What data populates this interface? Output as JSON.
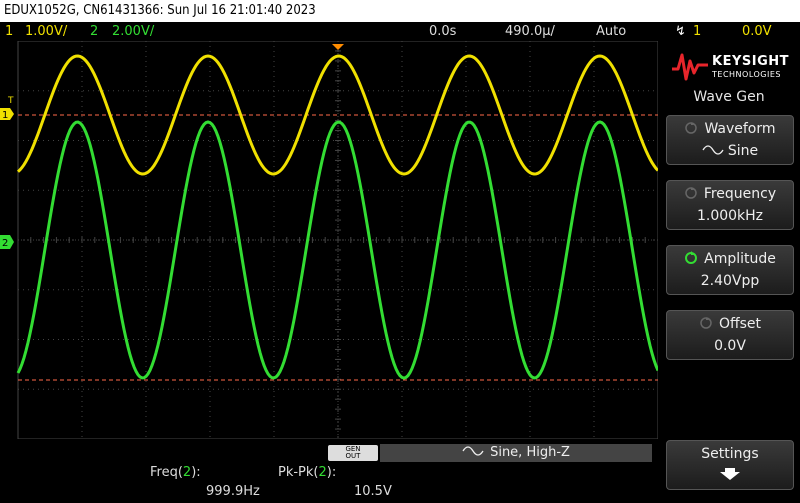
{
  "topbar": {
    "text": "EDUX1052G, CN61431366: Sun Jul 16 21:01:40 2023"
  },
  "status": {
    "ch1_num": "1",
    "ch1_scale": "1.00V/",
    "ch2_num": "2",
    "ch2_scale": "2.00V/",
    "time_delay": "0.0s",
    "time_scale": "490.0µ/",
    "trigger_mode": "Auto",
    "trigger_source": "1",
    "trigger_level": "0.0V"
  },
  "markers": {
    "trigger": "T",
    "ch1": "1",
    "ch2": "2"
  },
  "panel": {
    "brand": "KEYSIGHT",
    "brand_sub": "TECHNOLOGIES",
    "title": "Wave Gen",
    "softkeys": [
      {
        "label": "Waveform",
        "value": "Sine",
        "active": false
      },
      {
        "label": "Frequency",
        "value": "1.000kHz",
        "active": false
      },
      {
        "label": "Amplitude",
        "value": "2.40Vpp",
        "active": true
      },
      {
        "label": "Offset",
        "value": "0.0V",
        "active": false
      }
    ],
    "settings": "Settings"
  },
  "bottom": {
    "gen_out": "GEN OUT",
    "wave_status": "Sine, High-Z",
    "freq_label": "Freq(",
    "freq_ch": "2",
    "freq_close": "):",
    "freq_value": "999.9Hz",
    "pkpk_label": "Pk-Pk(",
    "pkpk_ch": "2",
    "pkpk_close": "):",
    "pkpk_value": "10.5V"
  },
  "colors": {
    "ch1": "#f0e000",
    "ch2": "#33dd33",
    "marker_line": "#ff6a4a",
    "trigger": "#ff8c00"
  }
}
